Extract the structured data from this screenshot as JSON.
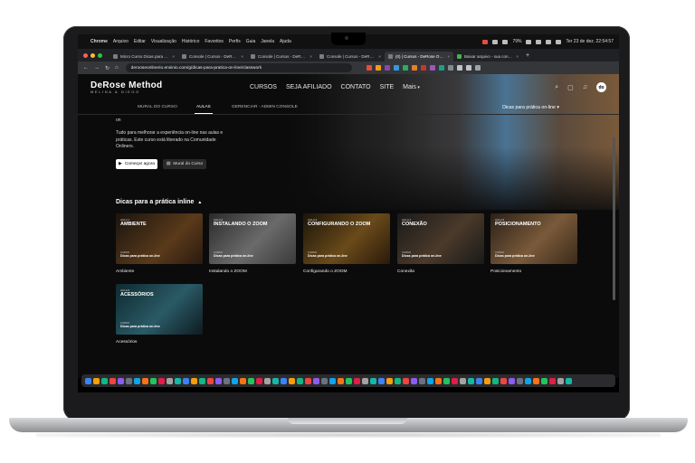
{
  "menubar": {
    "app": "Chrome",
    "items": [
      "Arquivo",
      "Editar",
      "Visualização",
      "Histórico",
      "Favoritos",
      "Perfis",
      "Guia",
      "Janela",
      "Ajuda"
    ],
    "battery": "79%",
    "datetime": "Ter 23 de dez.  22:54:57"
  },
  "browser": {
    "tabs": [
      {
        "title": "Micro Curso Dicas para Prát"
      },
      {
        "title": "Console | Cursos - DeRose"
      },
      {
        "title": "Console | Cursos - DeRose"
      },
      {
        "title": "Console | Cursos - DeRose"
      },
      {
        "title": "(0) | Cursos - DeRose Online"
      },
      {
        "title": "Baixar arquivo - sua conversão"
      }
    ],
    "active_tab": 4,
    "url": "derooseonlinerio.ensinio.com/g/dicas-para-pratica-on-line/classwork"
  },
  "site": {
    "logo": "DeRose Method",
    "logo_sub": "MELINA & DIEGO",
    "nav": [
      "CURSOS",
      "SEJA AFILIADO",
      "CONTATO",
      "SITE",
      "Mais"
    ],
    "avatar": "do",
    "subnav": [
      "MURAL DO CURSO",
      "AULAS",
      "GERENCIAR - ADMIN CONSOLE"
    ],
    "course_select": "Dicas para prática on-line",
    "hero_cut": "on",
    "hero_desc": "Tudo para melhorar a experiência on-line nas aulas e práticas. Este curso está liberado na Comunidade Onliners.",
    "btn_start": "Começar agora",
    "btn_mural": "Mural do Curso",
    "section_title": "Dicas para a prática inline",
    "cards": [
      {
        "lesson": "AULA 1",
        "title": "AMBIENTE",
        "tag": "CURSO",
        "course": "Dicas para prática on-line",
        "caption": "Ambiente"
      },
      {
        "lesson": "AULA 2",
        "title": "INSTALANDO O ZOOM",
        "tag": "CURSO",
        "course": "Dicas para prática on-line",
        "caption": "Instalando o ZOOM"
      },
      {
        "lesson": "AULA 3",
        "title": "CONFIGURANDO O ZOOM",
        "tag": "CURSO",
        "course": "Dicas para prática on-line",
        "caption": "Configurando o ZOOM"
      },
      {
        "lesson": "AULA 4",
        "title": "CONEXÃO",
        "tag": "CURSO",
        "course": "Dicas para prática on-line",
        "caption": "Conexão"
      },
      {
        "lesson": "AULA 5",
        "title": "POSICIONAMENTO",
        "tag": "CURSO",
        "course": "Dicas para prática on-line",
        "caption": "Posicionamento"
      },
      {
        "lesson": "AULA 6",
        "title": "ACESSÓRIOS",
        "tag": "CURSO",
        "course": "Dicas para prática on-line",
        "caption": "Acessórios"
      }
    ]
  },
  "colors": {
    "page_bg": "#0b0b0b",
    "card1": "#3a2a1a",
    "card2": "#4a4a4a",
    "card3": "#3a2a14",
    "card4": "#2a2a2a",
    "card5": "#4a3a2a",
    "card6": "#1a3a44"
  }
}
